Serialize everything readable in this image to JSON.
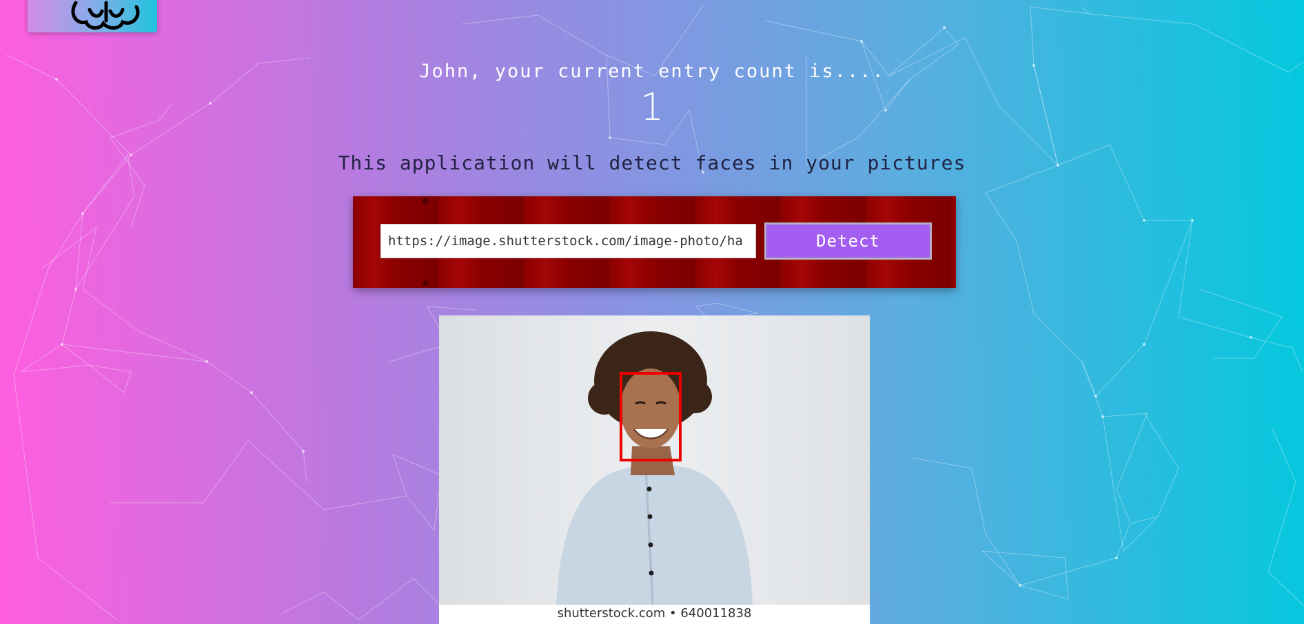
{
  "header": {
    "logo_icon": "brain-icon"
  },
  "rank": {
    "greeting": "John, your current entry count is....",
    "count": "1"
  },
  "intro": {
    "text": "This application will detect faces in your pictures"
  },
  "form": {
    "url_value": "https://image.shutterstock.com/image-photo/ha",
    "detect_label": "Detect"
  },
  "result": {
    "watermark": "shutterstock.com • 640011838",
    "face_box_color": "#ee0000"
  },
  "colors": {
    "gradient_start": "#ff5edf",
    "gradient_end": "#04c8de",
    "panel_red": "#8b0000",
    "button_purple": "#a35df0"
  }
}
